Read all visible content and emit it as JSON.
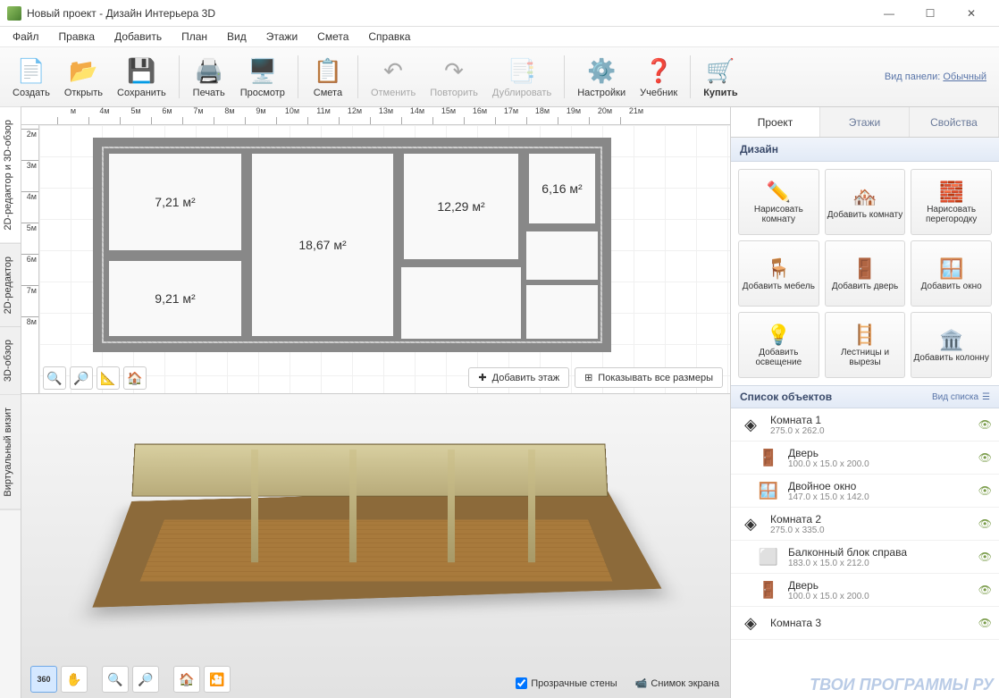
{
  "title": "Новый проект - Дизайн Интерьера 3D",
  "menu": [
    "Файл",
    "Правка",
    "Добавить",
    "План",
    "Вид",
    "Этажи",
    "Смета",
    "Справка"
  ],
  "toolbar": {
    "create": "Создать",
    "open": "Открыть",
    "save": "Сохранить",
    "print": "Печать",
    "preview": "Просмотр",
    "estimate": "Смета",
    "undo": "Отменить",
    "redo": "Повторить",
    "duplicate": "Дублировать",
    "settings": "Настройки",
    "tutorial": "Учебник",
    "buy": "Купить",
    "panel_label": "Вид панели:",
    "panel_mode": "Обычный"
  },
  "side_tabs": {
    "combined": "2D-редактор и 3D-обзор",
    "editor2d": "2D-редактор",
    "view3d": "3D-обзор",
    "virtual": "Виртуальный визит"
  },
  "ruler_h": [
    "м",
    "4м",
    "5м",
    "6м",
    "7м",
    "8м",
    "9м",
    "10м",
    "11м",
    "12м",
    "13м",
    "14м",
    "15м",
    "16м",
    "17м",
    "18м",
    "19м",
    "20м",
    "21м"
  ],
  "ruler_v": [
    "2м",
    "3м",
    "4м",
    "5м",
    "6м",
    "7м",
    "8м"
  ],
  "rooms": {
    "r1": "7,21 м²",
    "r2": "9,21 м²",
    "r3": "18,67 м²",
    "r4": "12,29 м²",
    "r5": "6,16 м²"
  },
  "plan_actions": {
    "add_floor": "Добавить этаж",
    "show_dims": "Показывать все размеры"
  },
  "view3d_opts": {
    "transparent": "Прозрачные стены",
    "screenshot": "Снимок экрана"
  },
  "rpanel": {
    "tabs": {
      "project": "Проект",
      "floors": "Этажи",
      "props": "Свойства"
    },
    "design_header": "Дизайн",
    "grid": {
      "draw_room": "Нарисовать комнату",
      "add_room": "Добавить комнату",
      "draw_partition": "Нарисовать перегородку",
      "add_furniture": "Добавить мебель",
      "add_door": "Добавить дверь",
      "add_window": "Добавить окно",
      "add_light": "Добавить освещение",
      "stairs": "Лестницы и вырезы",
      "add_column": "Добавить колонну"
    },
    "objlist_header": "Список объектов",
    "listmode": "Вид списка",
    "objects": [
      {
        "name": "Комната 1",
        "dims": "275.0 x 262.0",
        "icon": "room",
        "child": false
      },
      {
        "name": "Дверь",
        "dims": "100.0 x 15.0 x 200.0",
        "icon": "door",
        "child": true
      },
      {
        "name": "Двойное окно",
        "dims": "147.0 x 15.0 x 142.0",
        "icon": "window",
        "child": true
      },
      {
        "name": "Комната 2",
        "dims": "275.0 x 335.0",
        "icon": "room",
        "child": false
      },
      {
        "name": "Балконный блок справа",
        "dims": "183.0 x 15.0 x 212.0",
        "icon": "balcony",
        "child": true
      },
      {
        "name": "Дверь",
        "dims": "100.0 x 15.0 x 200.0",
        "icon": "door",
        "child": true
      },
      {
        "name": "Комната 3",
        "dims": "",
        "icon": "room",
        "child": false
      }
    ]
  },
  "watermark": "ТВОИ ПРОГРАММЫ РУ"
}
